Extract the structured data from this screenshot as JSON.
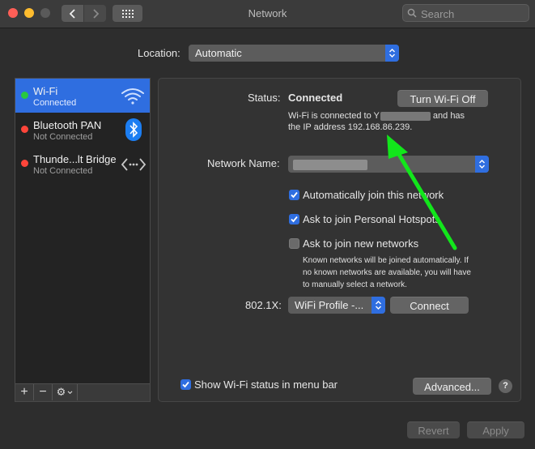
{
  "window": {
    "title": "Network"
  },
  "search": {
    "placeholder": "Search"
  },
  "location": {
    "label": "Location:",
    "value": "Automatic"
  },
  "services": [
    {
      "name": "Wi-Fi",
      "status": "Connected",
      "dot_color": "#28c840",
      "icon": "wifi-icon",
      "selected": true
    },
    {
      "name": "Bluetooth PAN",
      "status": "Not Connected",
      "dot_color": "#ff453a",
      "icon": "bluetooth-icon",
      "selected": false
    },
    {
      "name": "Thunde...lt Bridge",
      "status": "Not Connected",
      "dot_color": "#ff453a",
      "icon": "thunderbolt-bridge-icon",
      "selected": false
    }
  ],
  "sidebar_tools": {
    "add": "+",
    "remove": "−",
    "gear": "⚙"
  },
  "panel": {
    "status_label": "Status:",
    "status_value": "Connected",
    "turn_off_button": "Turn Wi-Fi Off",
    "status_desc_1": "Wi-Fi is connected to Y",
    "status_desc_2": "and has",
    "status_desc_3": "the IP address 192.168.86.239.",
    "network_name_label": "Network Name:",
    "auto_join": {
      "label": "Automatically join this network",
      "checked": true
    },
    "ask_hotspots": {
      "label": "Ask to join Personal Hotspots",
      "checked": true
    },
    "ask_new": {
      "label": "Ask to join new networks",
      "checked": false
    },
    "known_note_1": "Known networks will be joined automatically. If",
    "known_note_2": "no known networks are available, you will have",
    "known_note_3": "to manually select a network.",
    "dot1x_label": "802.1X:",
    "dot1x_value": "WiFi Profile -...",
    "connect_button": "Connect",
    "show_status": {
      "label": "Show Wi-Fi status in menu bar",
      "checked": true
    },
    "advanced_button": "Advanced...",
    "help_button": "?"
  },
  "footer": {
    "revert_button": "Revert",
    "apply_button": "Apply"
  },
  "colors": {
    "accent": "#2f6ee0",
    "arrow": "#12e61b"
  }
}
